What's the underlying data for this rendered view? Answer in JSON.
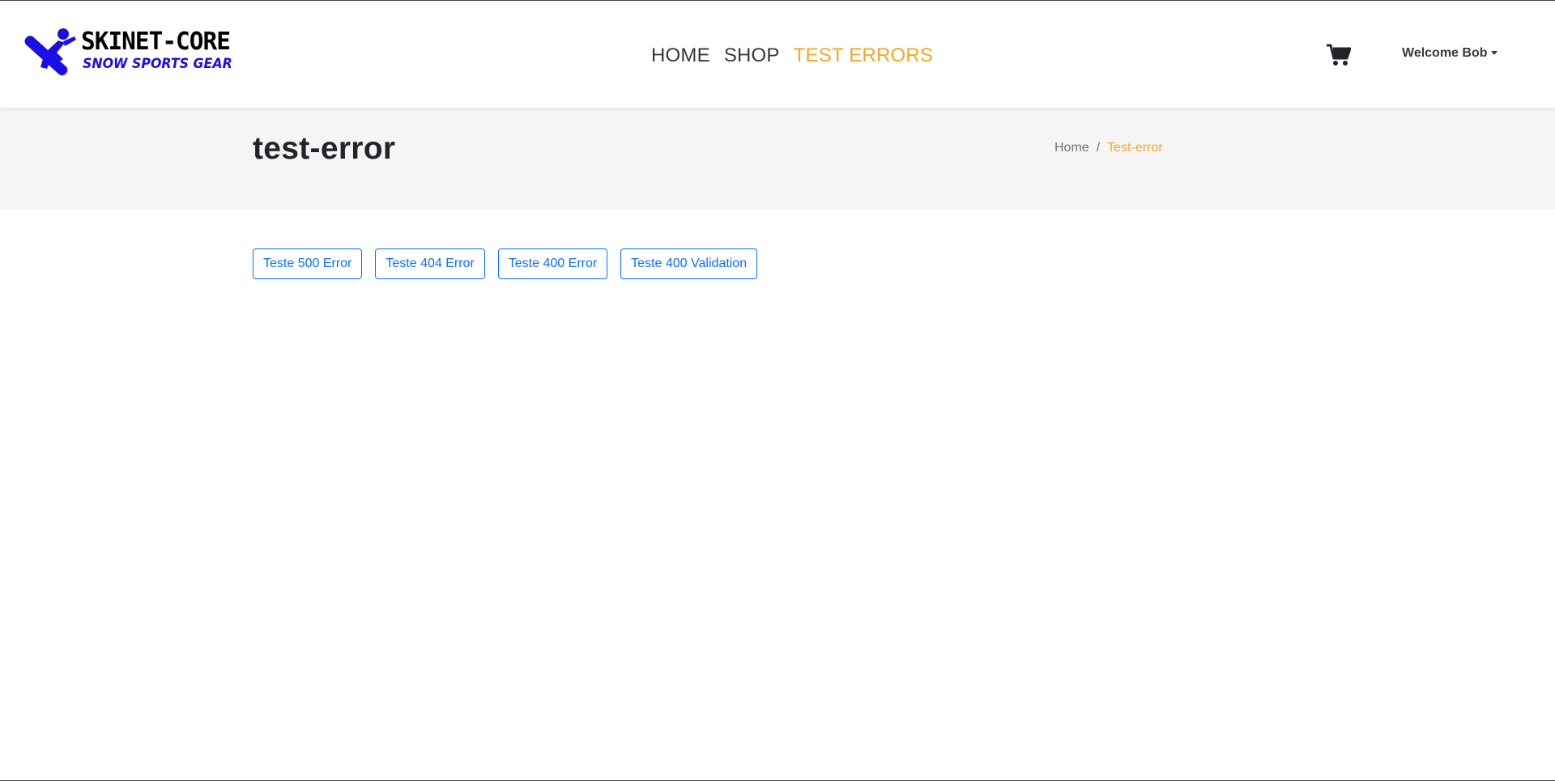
{
  "brand": {
    "title": "SKINET-CORE",
    "subtitle": "SNOW SPORTS GEAR",
    "logo_color": "#1a10e6"
  },
  "nav": {
    "items": [
      {
        "label": "HOME",
        "active": false
      },
      {
        "label": "SHOP",
        "active": false
      },
      {
        "label": "TEST ERRORS",
        "active": true
      }
    ]
  },
  "header_right": {
    "cart_icon": "shopping-cart-icon",
    "user_label": "Welcome Bob"
  },
  "section_header": {
    "title": "test-error",
    "breadcrumb": [
      {
        "label": "Home"
      },
      {
        "label": "Test-error"
      }
    ],
    "separator": "/"
  },
  "buttons": [
    {
      "label": "Teste 500 Error"
    },
    {
      "label": "Teste 404 Error"
    },
    {
      "label": "Teste 400 Error"
    },
    {
      "label": "Teste 400 Validation"
    }
  ],
  "colors": {
    "accent": "#f5a623",
    "primary": "#0d6efd",
    "band": "#f5f5f5"
  }
}
